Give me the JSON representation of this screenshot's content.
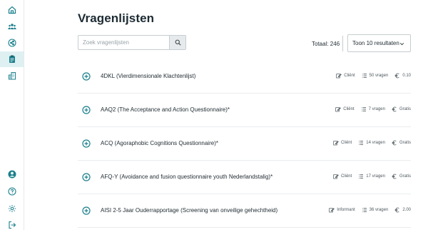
{
  "sidebar": {
    "items": [
      {
        "icon": "home-icon"
      },
      {
        "icon": "users-icon"
      },
      {
        "icon": "share-icon"
      },
      {
        "icon": "clipboard-icon"
      },
      {
        "icon": "buildings-icon"
      },
      {
        "icon": "avatar-icon"
      },
      {
        "icon": "help-icon"
      },
      {
        "icon": "gear-icon"
      },
      {
        "icon": "logout-icon"
      }
    ],
    "active_index": 3
  },
  "page": {
    "title": "Vragenlijsten",
    "search_placeholder": "Zoek vragenlijsten",
    "total": "Totaal: 246",
    "page_size_selected": "Toon 10 resultaten"
  },
  "colors": {
    "accent": "#1a7f8c",
    "active_bg": "#dff0f2"
  },
  "questionnaires": [
    {
      "name": "4DKL (Vierdimensionale Klachtenlijst)",
      "respondent": "Cliënt",
      "questions": "50 vragen",
      "price": "0.10"
    },
    {
      "name": "AAQ2 (The Acceptance and Action Questionnaire)*",
      "respondent": "Cliënt",
      "questions": "7 vragen",
      "price": "Gratis"
    },
    {
      "name": "ACQ (Agoraphobic Cognitions Questionnaire)*",
      "respondent": "Cliënt",
      "questions": "14 vragen",
      "price": "Gratis"
    },
    {
      "name": "AFQ-Y (Avoidance and fusion questionnaire youth Nederlandstalig)*",
      "respondent": "Cliënt",
      "questions": "17 vragen",
      "price": "Gratis"
    },
    {
      "name": "AISI 2-5 Jaar Ouderrapportage (Screening van onveilige gehechtheid)",
      "respondent": "Informant",
      "questions": "36 vragen",
      "price": "2.00"
    }
  ]
}
